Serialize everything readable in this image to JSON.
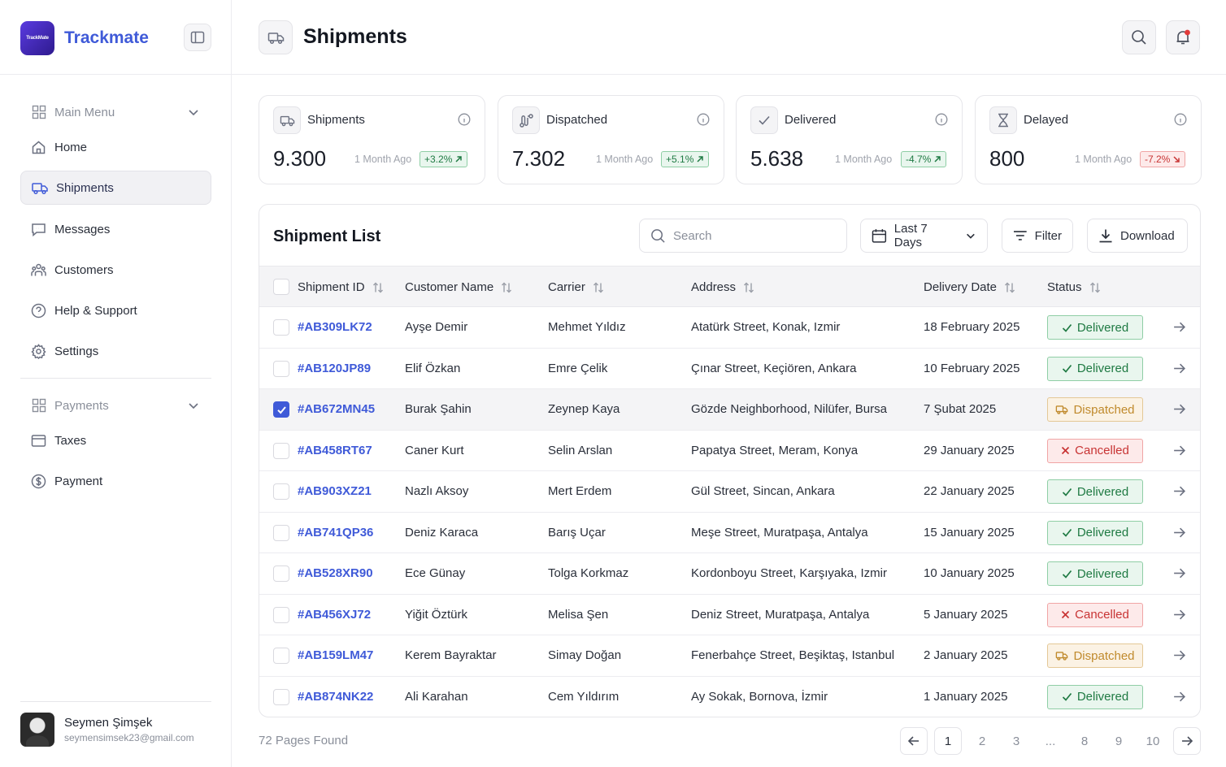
{
  "app": {
    "name": "Trackmate",
    "logo_text": "TrackMate"
  },
  "sidebar": {
    "main_menu_label": "Main Menu",
    "items": [
      {
        "label": "Home"
      },
      {
        "label": "Shipments"
      },
      {
        "label": "Messages"
      },
      {
        "label": "Customers"
      },
      {
        "label": "Help & Support"
      },
      {
        "label": "Settings"
      }
    ],
    "payments_label": "Payments",
    "payment_items": [
      {
        "label": "Taxes"
      },
      {
        "label": "Payment"
      }
    ],
    "user": {
      "name": "Seymen Şimşek",
      "email": "seymensimsek23@gmail.com"
    }
  },
  "header": {
    "title": "Shipments"
  },
  "stats": [
    {
      "label": "Shipments",
      "value": "9.300",
      "ago": "1 Month Ago",
      "change": "+3.2%",
      "trend": "up"
    },
    {
      "label": "Dispatched",
      "value": "7.302",
      "ago": "1 Month Ago",
      "change": "+5.1%",
      "trend": "up"
    },
    {
      "label": "Delivered",
      "value": "5.638",
      "ago": "1 Month Ago",
      "change": "-4.7%",
      "trend": "up"
    },
    {
      "label": "Delayed",
      "value": "800",
      "ago": "1 Month Ago",
      "change": "-7.2%",
      "trend": "down"
    }
  ],
  "list": {
    "title": "Shipment List",
    "search_placeholder": "Search",
    "date_range": "Last 7 Days",
    "filter_label": "Filter",
    "download_label": "Download",
    "columns": [
      "Shipment ID",
      "Customer Name",
      "Carrier",
      "Address",
      "Delivery Date",
      "Status"
    ],
    "rows": [
      {
        "id": "#AB309LK72",
        "customer": "Ayşe Demir",
        "carrier": "Mehmet Yıldız",
        "address": "Atatürk Street, Konak, Izmir",
        "date": "18 February 2025",
        "status": "Delivered",
        "checked": false
      },
      {
        "id": "#AB120JP89",
        "customer": "Elif Özkan",
        "carrier": "Emre Çelik",
        "address": "Çınar Street, Keçiören, Ankara",
        "date": "10 February 2025",
        "status": "Delivered",
        "checked": false
      },
      {
        "id": "#AB672MN45",
        "customer": "Burak Şahin",
        "carrier": "Zeynep Kaya",
        "address": "Gözde Neighborhood, Nilüfer, Bursa",
        "date": "7 Şubat 2025",
        "status": "Dispatched",
        "checked": true
      },
      {
        "id": "#AB458RT67",
        "customer": "Caner Kurt",
        "carrier": "Selin Arslan",
        "address": "Papatya Street, Meram, Konya",
        "date": "29 January 2025",
        "status": "Cancelled",
        "checked": false
      },
      {
        "id": "#AB903XZ21",
        "customer": "Nazlı Aksoy",
        "carrier": "Mert Erdem",
        "address": "Gül Street, Sincan, Ankara",
        "date": "22 January 2025",
        "status": "Delivered",
        "checked": false
      },
      {
        "id": "#AB741QP36",
        "customer": "Deniz Karaca",
        "carrier": "Barış Uçar",
        "address": "Meşe Street, Muratpaşa, Antalya",
        "date": "15 January 2025",
        "status": "Delivered",
        "checked": false
      },
      {
        "id": "#AB528XR90",
        "customer": "Ece Günay",
        "carrier": "Tolga Korkmaz",
        "address": "Kordonboyu Street, Karşıyaka, Izmir",
        "date": "10 January 2025",
        "status": "Delivered",
        "checked": false
      },
      {
        "id": "#AB456XJ72",
        "customer": "Yiğit Öztürk",
        "carrier": "Melisa Şen",
        "address": "Deniz Street, Muratpaşa, Antalya",
        "date": "5 January 2025",
        "status": "Cancelled",
        "checked": false
      },
      {
        "id": "#AB159LM47",
        "customer": "Kerem Bayraktar",
        "carrier": "Simay Doğan",
        "address": "Fenerbahçe Street, Beşiktaş, Istanbul",
        "date": "2 January 2025",
        "status": "Dispatched",
        "checked": false
      },
      {
        "id": "#AB874NK22",
        "customer": "Ali Karahan",
        "carrier": "Cem Yıldırım",
        "address": "Ay Sokak, Bornova, İzmir",
        "date": "1 January 2025",
        "status": "Delivered",
        "checked": false
      }
    ]
  },
  "pagination": {
    "pages_found": "72 Pages Found",
    "pages": [
      "1",
      "2",
      "3",
      "...",
      "8",
      "9",
      "10"
    ],
    "current": "1"
  },
  "colors": {
    "accent": "#3f5ad8",
    "delivered": "#1f7a43",
    "dispatched": "#c08a2c",
    "cancelled": "#c83434"
  },
  "icons": {
    "sidebar": [
      "home-icon",
      "truck-icon",
      "message-icon",
      "users-icon",
      "help-icon",
      "gear-icon"
    ],
    "payments": [
      "receipt-icon",
      "dollar-icon"
    ],
    "stats": [
      "truck-icon",
      "route-icon",
      "check-icon",
      "hourglass-icon"
    ]
  }
}
